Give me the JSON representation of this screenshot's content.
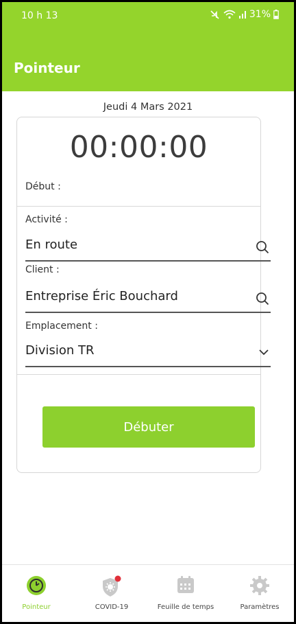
{
  "status_bar": {
    "time": "10 h 13",
    "battery": "31%"
  },
  "app_bar": {
    "title": "Pointeur"
  },
  "date": "Jeudi 4 Mars 2021",
  "timer": {
    "value": "00:00:00",
    "start_label": "Début :"
  },
  "fields": {
    "activity": {
      "label": "Activité :",
      "value": "En route",
      "icon": "search-icon"
    },
    "client": {
      "label": "Client :",
      "value": "Entreprise Éric Bouchard",
      "icon": "search-icon"
    },
    "location": {
      "label": "Emplacement :",
      "value": "Division TR",
      "icon": "chevron-down-icon"
    }
  },
  "start_button": {
    "label": "Débuter"
  },
  "bottom_nav": {
    "items": [
      {
        "label": "Pointeur",
        "icon": "stopwatch-icon",
        "active": true
      },
      {
        "label": "COVID-19",
        "icon": "shield-virus-icon",
        "badge": true
      },
      {
        "label": "Feuille de temps",
        "icon": "calendar-icon"
      },
      {
        "label": "Paramètres",
        "icon": "gear-icon"
      }
    ]
  },
  "colors": {
    "accent": "#94d42c",
    "button": "#8dd02e",
    "badge": "#e0303a",
    "icon_gray": "#c9c9c9"
  }
}
